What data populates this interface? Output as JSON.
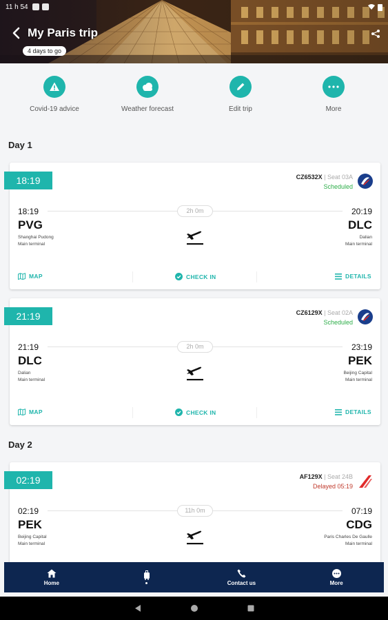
{
  "statusbar": {
    "time": "11 h 54"
  },
  "header": {
    "title": "My Paris trip",
    "countdown": "4 days to go"
  },
  "actions": [
    {
      "label": "Covid-19 advice",
      "icon": "warning-icon"
    },
    {
      "label": "Weather forecast",
      "icon": "cloud-icon"
    },
    {
      "label": "Edit trip",
      "icon": "pencil-icon"
    },
    {
      "label": "More",
      "icon": "ellipsis-icon"
    }
  ],
  "days": [
    {
      "label": "Day 1"
    },
    {
      "label": "Day 2"
    }
  ],
  "flights": [
    {
      "tag": "18:19",
      "number": "CZ6532X",
      "seat": "| Seat 03A",
      "status": "Scheduled",
      "status_color": "#2eae4a",
      "dep_time": "18:19",
      "arr_time": "20:19",
      "duration": "2h 0m",
      "dep_code": "PVG",
      "dep_name": "Shanghai Pudong",
      "dep_terminal": "Main terminal",
      "arr_code": "DLC",
      "arr_name": "Dalian",
      "arr_terminal": "Main terminal",
      "map": "MAP",
      "checkin": "CHECK IN",
      "details": "DETAILS"
    },
    {
      "tag": "21:19",
      "number": "CZ6129X",
      "seat": "| Seat 02A",
      "status": "Scheduled",
      "status_color": "#2eae4a",
      "dep_time": "21:19",
      "arr_time": "23:19",
      "duration": "2h 0m",
      "dep_code": "DLC",
      "dep_name": "Dalian",
      "dep_terminal": "Main terminal",
      "arr_code": "PEK",
      "arr_name": "Beijing Capital",
      "arr_terminal": "Main terminal",
      "map": "MAP",
      "checkin": "CHECK IN",
      "details": "DETAILS"
    },
    {
      "tag": "02:19",
      "number": "AF129X",
      "seat": "| Seat 24B",
      "status": "Delayed 05:19",
      "status_color": "#c0392b",
      "dep_time": "02:19",
      "arr_time": "07:19",
      "duration": "11h 0m",
      "dep_code": "PEK",
      "dep_name": "Beijing Capital",
      "dep_terminal": "Main terminal",
      "arr_code": "CDG",
      "arr_name": "Paris Charles De Gaulle",
      "arr_terminal": "Main terminal"
    }
  ],
  "bottom_nav": [
    {
      "label": "Home",
      "icon": "home-icon"
    },
    {
      "label": "",
      "icon": "luggage-icon"
    },
    {
      "label": "Contact us",
      "icon": "phone-icon"
    },
    {
      "label": "More",
      "icon": "ellipsis-icon"
    }
  ],
  "colors": {
    "accent": "#1fb5ac",
    "nav": "#0d2650",
    "scheduled": "#2eae4a",
    "delayed": "#c0392b"
  }
}
